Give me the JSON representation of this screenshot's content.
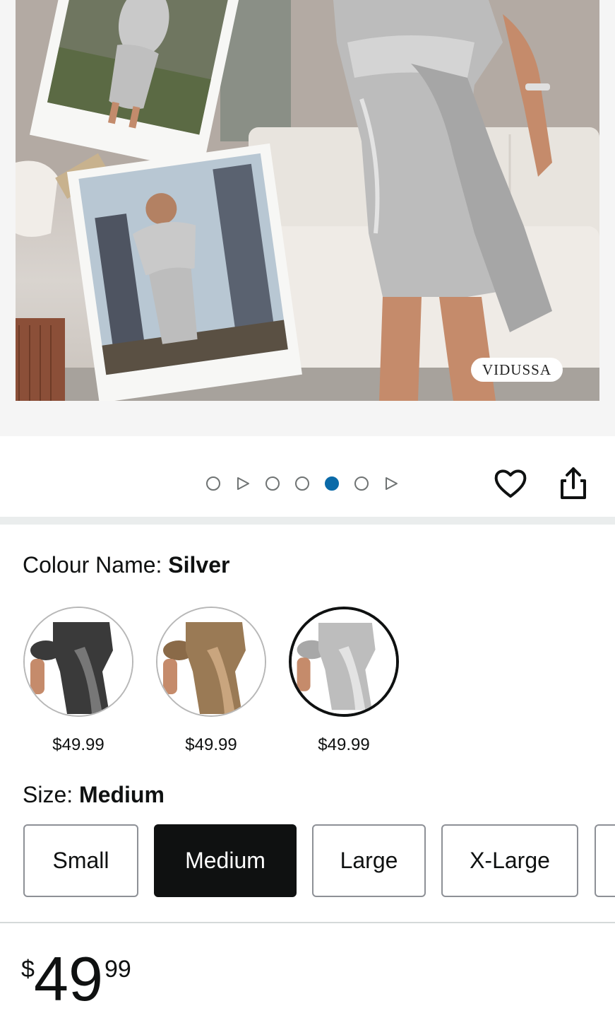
{
  "product": {
    "brand_tag": "VIDUSSA",
    "image_count": 7,
    "active_image_index": 5
  },
  "carousel": {
    "items": [
      "image",
      "video",
      "image",
      "image",
      "image",
      "image",
      "video"
    ]
  },
  "actions": {
    "wishlist_icon": "heart-icon",
    "share_icon": "share-icon"
  },
  "colour": {
    "label": "Colour Name: ",
    "selected": "Silver",
    "options": [
      {
        "name": "Black",
        "price": "$49.99",
        "color": "#3a3a3a"
      },
      {
        "name": "Gold",
        "price": "$49.99",
        "color": "#9a7a55"
      },
      {
        "name": "Silver",
        "price": "$49.99",
        "color": "#bdbdbd",
        "selected": true
      }
    ]
  },
  "size": {
    "label": "Size: ",
    "selected": "Medium",
    "options": [
      "Small",
      "Medium",
      "Large",
      "X-Large"
    ]
  },
  "price": {
    "symbol": "$",
    "whole": "49",
    "fraction": "99"
  },
  "colors": {
    "accent_dot": "#0a6aa8",
    "selected_size_bg": "#0f1111"
  }
}
